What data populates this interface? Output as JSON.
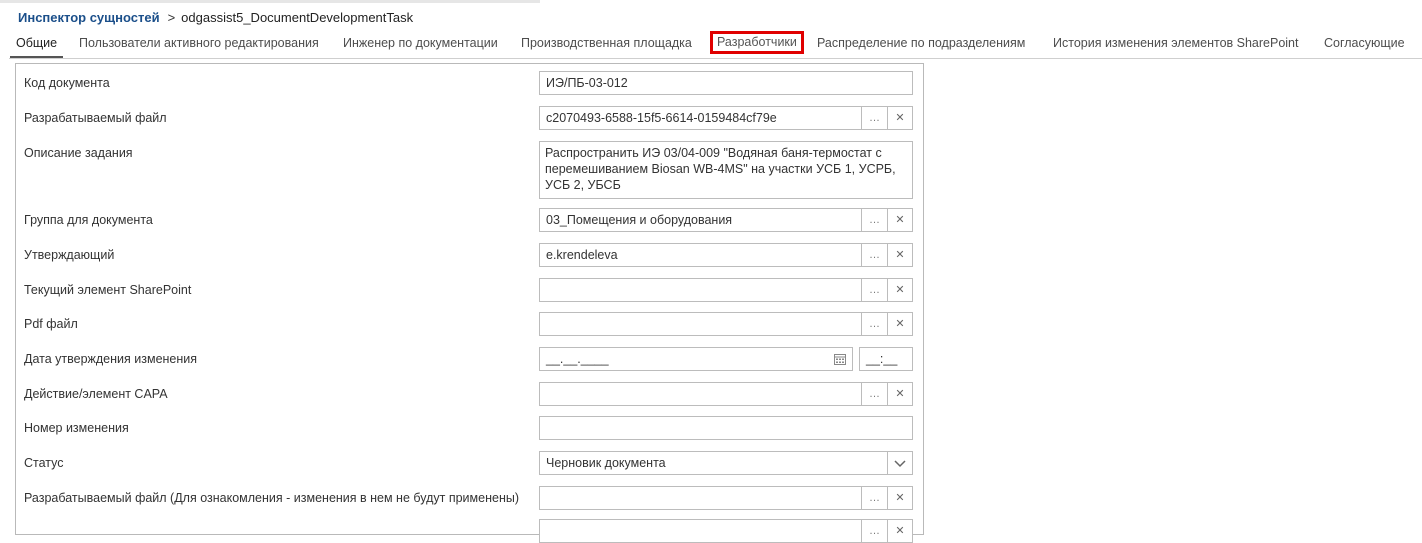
{
  "breadcrumb": {
    "root": "Инспектор сущностей",
    "separator": ">",
    "current": "odgassist5_DocumentDevelopmentTask"
  },
  "tabs": [
    {
      "label": "Общие",
      "active": true
    },
    {
      "label": "Пользователи активного редактирования"
    },
    {
      "label": "Инженер по документации"
    },
    {
      "label": "Производственная площадка"
    },
    {
      "label": "Разработчики",
      "highlighted": true
    },
    {
      "label": "Распределение по подразделениям"
    },
    {
      "label": "История изменения элементов SharePoint"
    },
    {
      "label": "Согласующие"
    }
  ],
  "form": {
    "doc_code": {
      "label": "Код документа",
      "value": "ИЭ/ПБ-03-012"
    },
    "dev_file": {
      "label": "Разрабатываемый файл",
      "value": "c2070493-6588-15f5-6614-0159484cf79e"
    },
    "task_desc": {
      "label": "Описание задания",
      "value": "Распространить ИЭ 03/04-009 \"Водяная баня-термостат с перемешиванием Biosan WB-4MS\" на участки УСБ 1, УСРБ, УСБ 2, УБСБ"
    },
    "doc_group": {
      "label": "Группа для документа",
      "value": "03_Помещения и оборудования"
    },
    "approver": {
      "label": "Утверждающий",
      "value": "e.krendeleva"
    },
    "sharepoint_item": {
      "label": "Текущий элемент SharePoint",
      "value": ""
    },
    "pdf_file": {
      "label": "Pdf файл",
      "value": ""
    },
    "approval_date": {
      "label": "Дата утверждения изменения",
      "date_value": "__.__.____",
      "time_value": "__:__"
    },
    "capa": {
      "label": "Действие/элемент CAPA",
      "value": ""
    },
    "change_number": {
      "label": "Номер изменения",
      "value": ""
    },
    "status": {
      "label": "Статус",
      "value": "Черновик документа"
    },
    "dev_file_review": {
      "label": "Разрабатываемый файл (Для ознакомления - изменения в нем не будут применены)",
      "value": ""
    }
  },
  "icons": {
    "dots": "…",
    "clear": "✕",
    "calendar": "calendar-icon",
    "dropdown": "chevron-down-icon"
  },
  "colors": {
    "breadcrumb_root": "#1b4f8a",
    "highlight": "#e00000"
  }
}
